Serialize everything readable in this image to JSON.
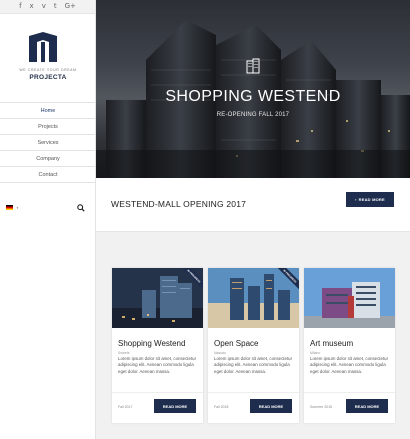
{
  "social": [
    {
      "icon": "facebook-icon",
      "glyph": "f"
    },
    {
      "icon": "xing-icon",
      "glyph": "x"
    },
    {
      "icon": "vimeo-icon",
      "glyph": "v"
    },
    {
      "icon": "tumblr-icon",
      "glyph": "t"
    },
    {
      "icon": "google-plus-icon",
      "glyph": "G+"
    }
  ],
  "brand": {
    "tagline": "WE CREATE YOUR DREAM",
    "name": "PROJECTA"
  },
  "nav": [
    "Home",
    "Projects",
    "Services",
    "Company",
    "Contact"
  ],
  "nav_active": "Home",
  "hero": {
    "title": "SHOPPING WESTEND",
    "subtitle": "RE-OPENING FALL 2017",
    "icon": "building-icon"
  },
  "banner": {
    "title": "WESTEND-MALL OPENING 2017",
    "button": "READ MORE"
  },
  "cards": [
    {
      "title": "Shopping Westend",
      "category": "Sweets",
      "text": "Lorem ipsum dolor sit amet, consectetur adipiscing elit. Aenean commodo ligula eget dolor. Aenean massa.",
      "date": "Fall 2017",
      "button": "READ MORE",
      "ribbon": "IN PROGRESS"
    },
    {
      "title": "Open Space",
      "category": "Nassau",
      "text": "Lorem ipsum dolor sit amet, consectetur adipiscing elit. Aenean commodo ligula eget dolor. Aenean massa.",
      "date": "Fall 2018",
      "button": "READ MORE",
      "ribbon": "IN PROGRESS"
    },
    {
      "title": "Art museum",
      "category": "Milano",
      "text": "Lorem ipsum dolor sit amet, consectetur adipiscing elit. Aenean commodo ligula eget dolor. Aenean massa.",
      "date": "Summer 2015",
      "button": "READ MORE",
      "ribbon": ""
    }
  ],
  "colors": {
    "accent": "#1e2d4e",
    "sidebar_bg": "#ffffff",
    "content_bg": "#f1f1f1"
  }
}
